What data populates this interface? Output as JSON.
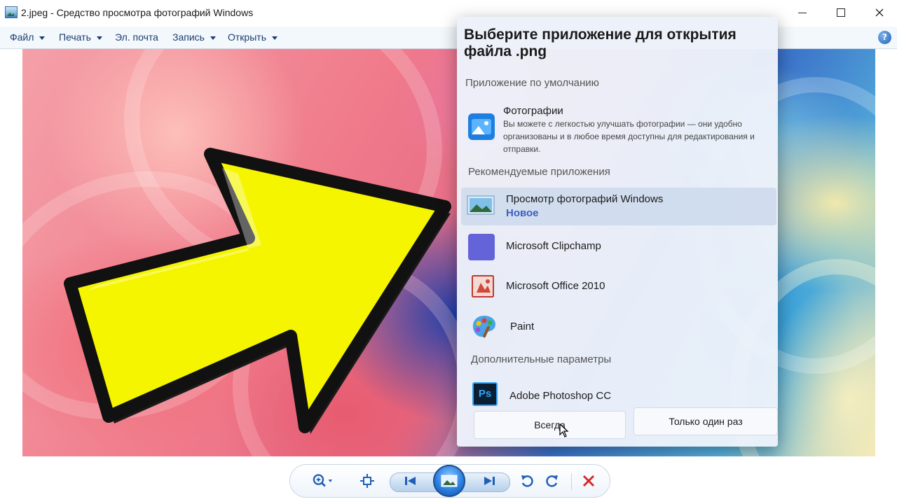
{
  "window": {
    "title": "2.jpeg - Средство просмотра фотографий Windows",
    "minimize_icon": "minimize-icon",
    "maximize_icon": "maximize-icon",
    "close_icon": "close-icon"
  },
  "menu": {
    "items": [
      {
        "label": "Файл",
        "has_arrow": true
      },
      {
        "label": "Печать",
        "has_arrow": true
      },
      {
        "label": "Эл. почта",
        "has_arrow": false
      },
      {
        "label": "Запись",
        "has_arrow": true
      },
      {
        "label": "Открыть",
        "has_arrow": true
      }
    ],
    "help_label": "?"
  },
  "dialog": {
    "title": "Выберите приложение для открытия файла .png",
    "default_section": "Приложение по умолчанию",
    "default_app": {
      "name": "Фотографии",
      "description": "Вы можете с легкостью улучшать фотографии — они удобно организованы и в любое время доступны для редактирования и отправки.",
      "icon": "photos-app-icon"
    },
    "recommended_section": "Рекомендуемые приложения",
    "recommended_apps": [
      {
        "name": "Просмотр фотографий Windows",
        "subtitle": "Новое",
        "icon": "windows-photo-viewer-icon",
        "selected": true
      },
      {
        "name": "Microsoft Clipchamp",
        "icon": "clipchamp-icon"
      },
      {
        "name": "Microsoft Office 2010",
        "icon": "office-2010-icon"
      },
      {
        "name": "Paint",
        "icon": "paint-icon"
      }
    ],
    "more_section": "Дополнительные параметры",
    "more_apps": [
      {
        "name": "Adobe Photoshop CC",
        "icon": "photoshop-icon",
        "icon_text": "Ps"
      }
    ],
    "buttons": {
      "always": "Всегда",
      "once": "Только один раз"
    }
  },
  "toolbar": {
    "zoom_icon": "zoom-icon",
    "fit_icon": "actual-size-icon",
    "prev_icon": "previous-icon",
    "slideshow_icon": "slideshow-icon",
    "next_icon": "next-icon",
    "rotate_left_icon": "rotate-left-icon",
    "rotate_right_icon": "rotate-right-icon",
    "delete_icon": "delete-icon"
  },
  "colors": {
    "menu_text": "#1c3d6e",
    "arrow_fill": "#f5f500",
    "arrow_outline": "#111111",
    "link_blue": "#3a5fc0",
    "delete_red": "#d42a2a"
  }
}
